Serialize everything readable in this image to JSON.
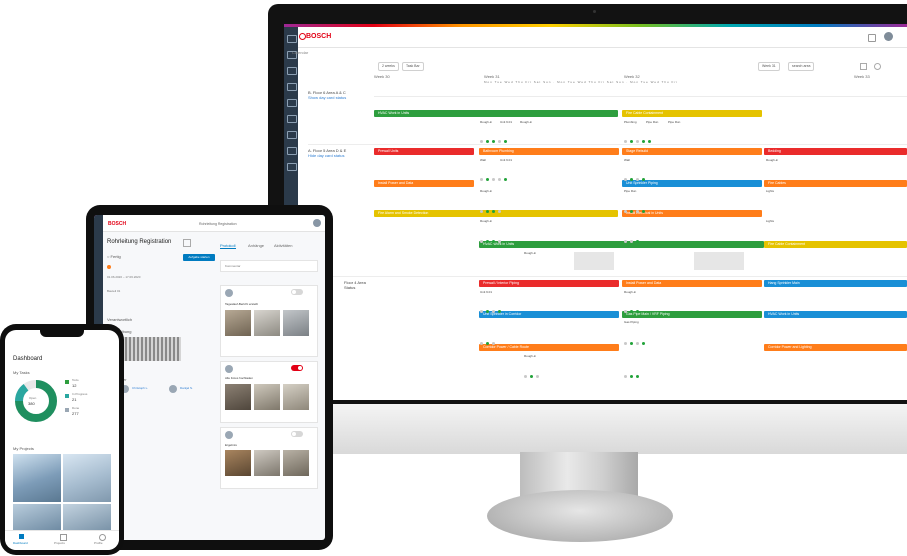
{
  "colors": {
    "bosch_red": "#e20015",
    "green": "#2e9e3e",
    "orange": "#ff7d1a",
    "yellow": "#e5c300",
    "red": "#ea2b2b",
    "blue": "#1a8fd6",
    "rail": "#2b3a4a"
  },
  "monitor": {
    "brand": "BOSCH",
    "breadcrumb": "Calendar",
    "toolbar": {
      "btn1": "2 weeks",
      "btn2": "Task Bar",
      "week_nav": "Week 31",
      "search": "search area"
    },
    "weeks": [
      "Week 30",
      "Week 31",
      "Week 32",
      "Week 33"
    ],
    "rows": [
      {
        "label": "B. Floor 6 Area A & C",
        "sub": "Show day card status"
      },
      {
        "label": "A. Floor 5 Area D & E",
        "sub": "Hide day card status"
      },
      {
        "label": "Floor 4 Area",
        "sub": "Status"
      }
    ],
    "bars": [
      {
        "label": "HVAC Work in Units",
        "color": "green"
      },
      {
        "label": "Fire Cable Containment",
        "color": "yellow"
      },
      {
        "label": "Prewall Units",
        "color": "red"
      },
      {
        "label": "Bathroom Plumbing",
        "color": "orange"
      },
      {
        "label": "Stage Rebuild",
        "color": "orange"
      },
      {
        "label": "Bedding",
        "color": "red"
      },
      {
        "label": "Install Power and Data",
        "color": "orange"
      },
      {
        "label": "Unit Sprinkler Piping",
        "color": "blue"
      },
      {
        "label": "Fire Cables",
        "color": "orange"
      },
      {
        "label": "Fire Alarm and Smoke Detection",
        "color": "yellow"
      },
      {
        "label": "Install Electrical in Units",
        "color": "orange"
      },
      {
        "label": "HVAC Work in Units",
        "color": "green"
      },
      {
        "label": "Fire Cable Containment",
        "color": "yellow"
      },
      {
        "label": "Prewall / Interior Piping",
        "color": "red"
      },
      {
        "label": "Install Power and Data",
        "color": "orange"
      },
      {
        "label": "Hang Sprinkler Main",
        "color": "blue"
      },
      {
        "label": "Unit Sprinkler in Corridor",
        "color": "blue"
      },
      {
        "label": "Gas Pipe Main / VRF Piping",
        "color": "green"
      },
      {
        "label": "HVAC Work in Units",
        "color": "blue"
      },
      {
        "label": "Corridor Power / Cable Route",
        "color": "orange"
      },
      {
        "label": "Corridor Power and Lighting",
        "color": "orange"
      }
    ],
    "cell_texts": [
      "Rough-in",
      "Unit 9.01",
      "Plumbing",
      "Lights",
      "Pipe Run",
      "Wall",
      "Gas Piping"
    ]
  },
  "tablet": {
    "brand": "BOSCH",
    "breadcrumb": "Rohrleitung Registration",
    "title": "Rohrleitung Registration",
    "tabs": [
      "Protokoll",
      "Anhänge",
      "Aktivitäten"
    ],
    "status_button": "Aufgabe starten",
    "comment_placeholder": "Kommentar",
    "field1": "Fertig",
    "caption1": "Tageslauf-Bericht erstellt",
    "caption2": "Alle Fotos hochladen",
    "caption3": "Ergebnis",
    "field_labels": [
      "Verantwortlich",
      "Beschreibung",
      "Teilnehmer"
    ],
    "people": [
      "Christoph L.",
      "Danijel S."
    ]
  },
  "phone": {
    "title": "Dashboard",
    "tasks_heading": "My Tasks",
    "donut_total_label": "Open",
    "donut_total": "380",
    "legend": [
      {
        "label": "Todo",
        "value": "12"
      },
      {
        "label": "In Progress",
        "value": "21"
      },
      {
        "label": "Done",
        "value": "277"
      }
    ],
    "projects_heading": "My Projects",
    "nav": [
      "Dashboard",
      "Projects",
      "Profile"
    ]
  }
}
